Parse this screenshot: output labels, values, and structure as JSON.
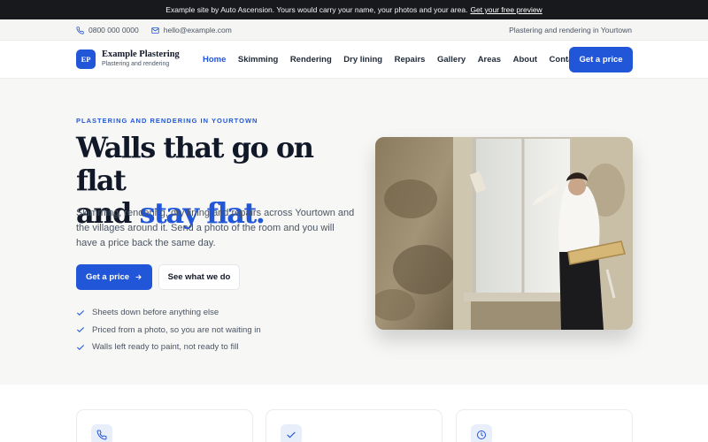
{
  "banner": {
    "text": "Example site by Auto Ascension. Yours would carry your name, your photos and your area.",
    "link": "Get your free preview"
  },
  "contact": {
    "phone": "0800 000 0000",
    "email": "hello@example.com",
    "area": "Plastering and rendering in Yourtown",
    "phone_icon": "phone-icon",
    "email_icon": "mail-icon"
  },
  "brand": {
    "monogram": "EP",
    "name": "Example Plastering",
    "tagline": "Plastering and rendering"
  },
  "nav": {
    "items": [
      "Home",
      "Skimming",
      "Rendering",
      "Dry lining",
      "Repairs",
      "Gallery",
      "Areas",
      "About",
      "Contact"
    ],
    "active": "Home",
    "cta": "Get a price"
  },
  "hero": {
    "eyebrow": "PLASTERING AND RENDERING IN YOURTOWN",
    "headline_line1": "Walls that go on flat",
    "headline_and": "and",
    "headline_accent": "stay flat.",
    "lede": "Skimming, rendering, dry lining and repairs across Yourtown and the villages around it. Send a photo of the room and you will have a price back the same day.",
    "primary_button": "Get a price",
    "secondary_button": "See what we do",
    "checklist": [
      "Sheets down before anything else",
      "Priced from a photo, so you are not waiting in",
      "Walls left ready to paint, not ready to fill"
    ]
  },
  "feature_cards": [
    {
      "icon": "phone-icon"
    },
    {
      "icon": "check-icon"
    },
    {
      "icon": "clock-icon"
    }
  ],
  "colors": {
    "accent": "#2156d9",
    "banner_bg": "#17191c",
    "hero_bg": "#f7f7f6",
    "heading": "#111827"
  }
}
